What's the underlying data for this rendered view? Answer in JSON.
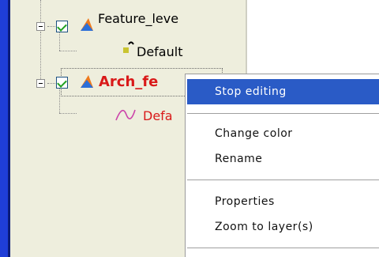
{
  "tree": {
    "layers": [
      {
        "name": "Feature_leve",
        "checked": true,
        "sublayer": {
          "label": "Default",
          "icon": "point-symbol-icon"
        }
      },
      {
        "name": "Arch_fe",
        "checked": true,
        "color": "#d91919",
        "sublayer": {
          "label": "Defa",
          "icon": "line-symbol-icon"
        }
      }
    ]
  },
  "context_menu": {
    "items": [
      {
        "label": "Stop editing",
        "highlighted": true
      },
      {
        "label": "Change color"
      },
      {
        "label": "Rename"
      },
      {
        "label": "Properties"
      },
      {
        "label": "Zoom to layer(s)"
      }
    ]
  },
  "colors": {
    "highlight": "#2a5bc6",
    "active_layer_text": "#d91919",
    "tree_background": "#eeeedd"
  }
}
